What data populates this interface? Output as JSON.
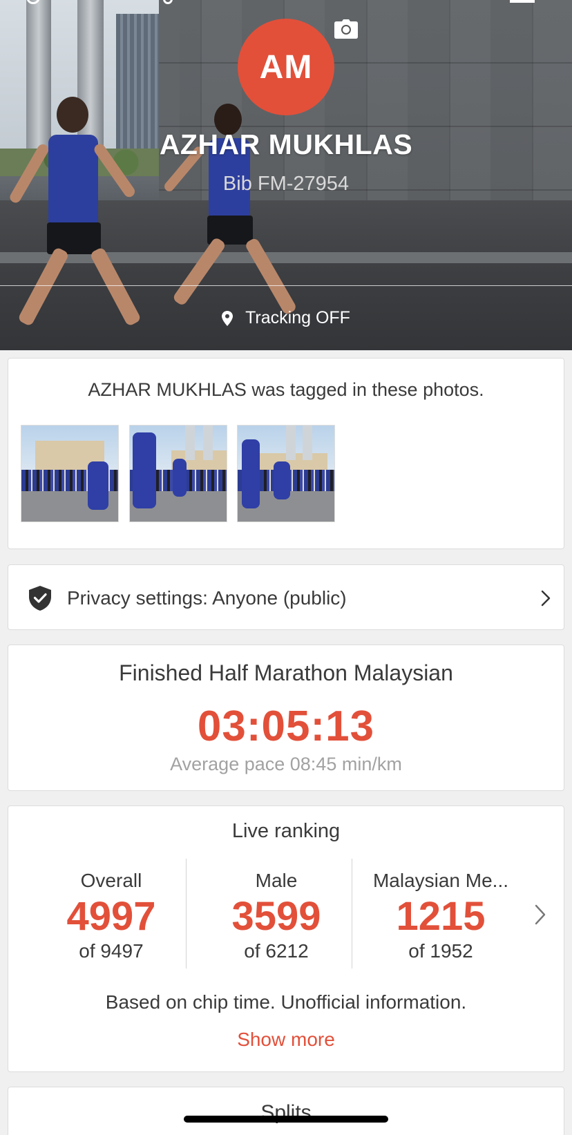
{
  "profile": {
    "initials": "AM",
    "name": "AZHAR MUKHLAS",
    "bib": "Bib FM-27954",
    "tracking_status": "Tracking OFF"
  },
  "photos": {
    "title": "AZHAR MUKHLAS was tagged in these photos.",
    "count": 3
  },
  "privacy": {
    "label": "Privacy settings: Anyone (public)"
  },
  "finish": {
    "title": "Finished Half Marathon Malaysian",
    "time": "03:05:13",
    "pace": "Average pace 08:45 min/km"
  },
  "ranking": {
    "title": "Live ranking",
    "columns": [
      {
        "label": "Overall",
        "value": "4997",
        "of": "of 9497"
      },
      {
        "label": "Male",
        "value": "3599",
        "of": "of 6212"
      },
      {
        "label": "Malaysian Me...",
        "value": "1215",
        "of": "of 1952"
      }
    ],
    "note": "Based on chip time. Unofficial information.",
    "show_more": "Show more"
  },
  "splits": {
    "title": "Splits"
  },
  "colors": {
    "accent": "#e2503a",
    "muted_text": "#a2a2a2",
    "text": "#3a3a3a"
  }
}
